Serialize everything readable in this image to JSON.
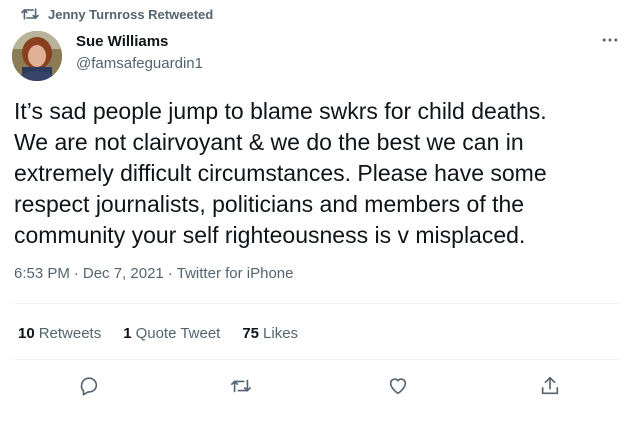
{
  "retweet_banner": {
    "icon": "retweet-icon",
    "text": "Jenny Turnross Retweeted"
  },
  "author": {
    "avatar": "avatar-photo",
    "display_name": "Sue Williams",
    "handle": "@famsafeguardin1"
  },
  "more_icon": "more-dots-icon",
  "tweet": {
    "text": "It’s sad people jump to blame swkrs for child deaths.\nWe are not clairvoyant & we do the best we can in\nextremely difficult circumstances.  Please have some\nrespect journalists, politicians and members of the\ncommunity your self righteousness is v misplaced.",
    "time": "6:53 PM",
    "date": "Dec 7, 2021",
    "source": "Twitter for iPhone",
    "separator": "·"
  },
  "stats": {
    "retweets_count": "10",
    "retweets_label": "Retweets",
    "quotes_count": "1",
    "quotes_label": "Quote Tweet",
    "likes_count": "75",
    "likes_label": "Likes"
  },
  "actions": {
    "reply_icon": "reply-icon",
    "retweet_icon": "retweet-icon",
    "like_icon": "like-heart-icon",
    "share_icon": "share-icon"
  },
  "colors": {
    "text_primary": "#0f1419",
    "text_secondary": "#536471",
    "divider": "#eff3f4"
  }
}
